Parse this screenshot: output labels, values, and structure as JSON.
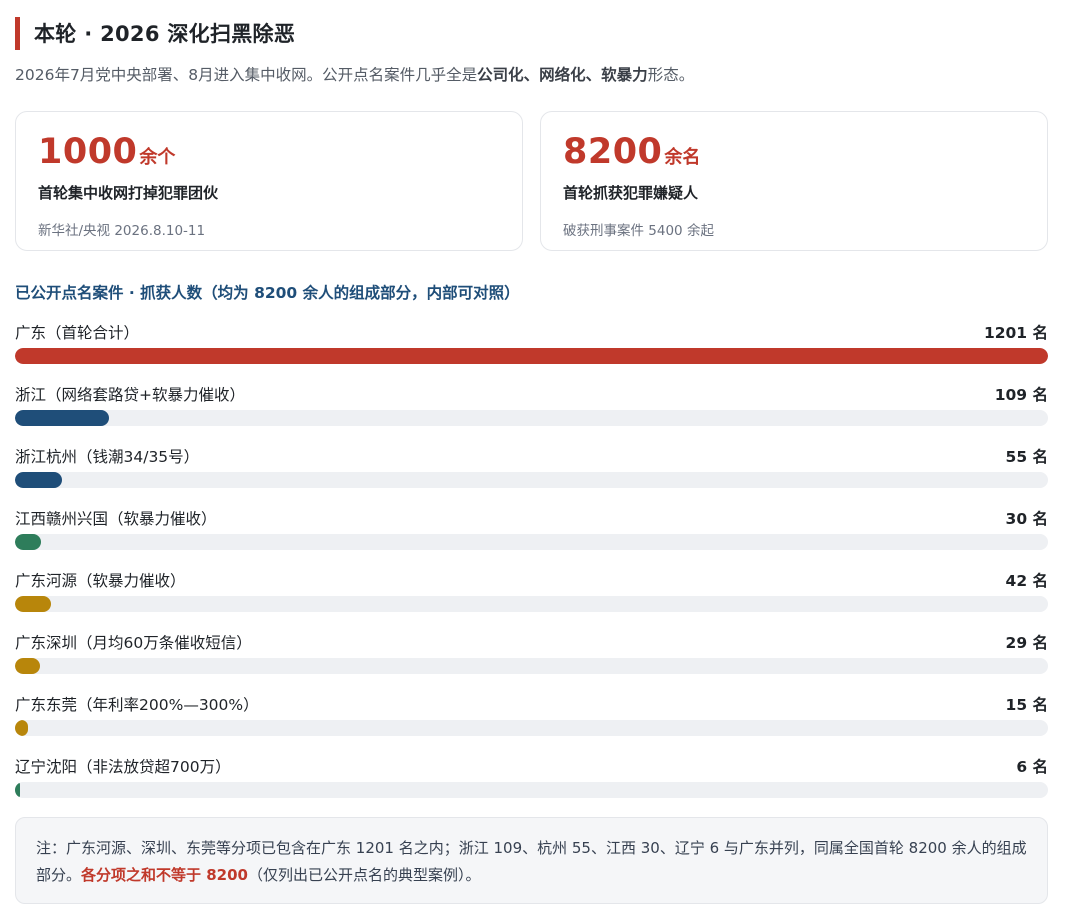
{
  "header": {
    "title": "本轮 · 2026 深化扫黑除恶",
    "subtitle_pre": "2026年7月党中央部署、8月进入集中收网。公开点名案件几乎全是",
    "subtitle_bold": "公司化、网络化、软暴力",
    "subtitle_post": "形态。"
  },
  "cards": [
    {
      "number": "1000",
      "unit": "余个",
      "label": "首轮集中收网打掉犯罪团伙",
      "source": "新华社/央视 2026.8.10-11"
    },
    {
      "number": "8200",
      "unit": "余名",
      "label": "首轮抓获犯罪嫌疑人",
      "source": "破获刑事案件 5400 余起"
    }
  ],
  "colors": {
    "accent": "#c0392b",
    "blue": "#1f4e79",
    "green": "#2e7d5b",
    "gold": "#b8860b",
    "track": "#eef0f3"
  },
  "chart_data": {
    "type": "bar",
    "title": "已公开点名案件 · 抓获人数（均为 8200 余人的组成部分，内部可对照）",
    "orientation": "horizontal",
    "xlim": [
      0,
      1201
    ],
    "unit": "名",
    "categories": [
      "广东（首轮合计）",
      "浙江（网络套路贷+软暴力催收）",
      "浙江杭州（钱潮34/35号）",
      "江西赣州兴国（软暴力催收）",
      "广东河源（软暴力催收）",
      "广东深圳（月均60万条催收短信）",
      "广东东莞（年利率200%—300%）",
      "辽宁沈阳（非法放贷超700万）"
    ],
    "values": [
      1201,
      109,
      55,
      30,
      42,
      29,
      15,
      6
    ],
    "value_labels": [
      "1201 名",
      "109 名",
      "55 名",
      "30 名",
      "42 名",
      "29 名",
      "15 名",
      "6 名"
    ],
    "bar_colors": [
      "#c0392b",
      "#1f4e79",
      "#1f4e79",
      "#2e7d5b",
      "#b8860b",
      "#b8860b",
      "#b8860b",
      "#2e7d5b"
    ]
  },
  "note": {
    "text_pre": "注：广东河源、深圳、东莞等分项已包含在广东 1201 名之内；浙江 109、杭州 55、江西 30、辽宁 6 与广东并列，同属全国首轮 8200 余人的组成部分。",
    "text_highlight": "各分项之和不等于 8200",
    "text_post": "（仅列出已公开点名的典型案例）。"
  }
}
